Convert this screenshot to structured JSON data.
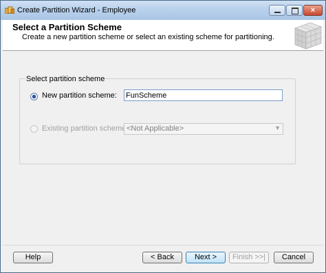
{
  "window": {
    "title": "Create Partition Wizard - Employee",
    "close_glyph": "×"
  },
  "header": {
    "title": "Select a Partition Scheme",
    "subtitle": "Create a new partition scheme or select an existing scheme for partitioning.",
    "graphic_icon": "cube-grid-icon"
  },
  "group": {
    "label": "Select partition scheme"
  },
  "options": {
    "new_label": "New partition scheme:",
    "new_selected": true,
    "new_value": "FunScheme",
    "existing_label": "Existing partition scheme:",
    "existing_selected": false,
    "existing_value": "<Not Applicable>",
    "dropdown_glyph": "▼"
  },
  "buttons": {
    "help": "Help",
    "back": "< Back",
    "next": "Next >",
    "finish": "Finish >>|",
    "cancel": "Cancel"
  },
  "colors": {
    "title_bar": "#b9d1ec",
    "accent": "#2b55a8",
    "close_button": "#c9472f"
  }
}
